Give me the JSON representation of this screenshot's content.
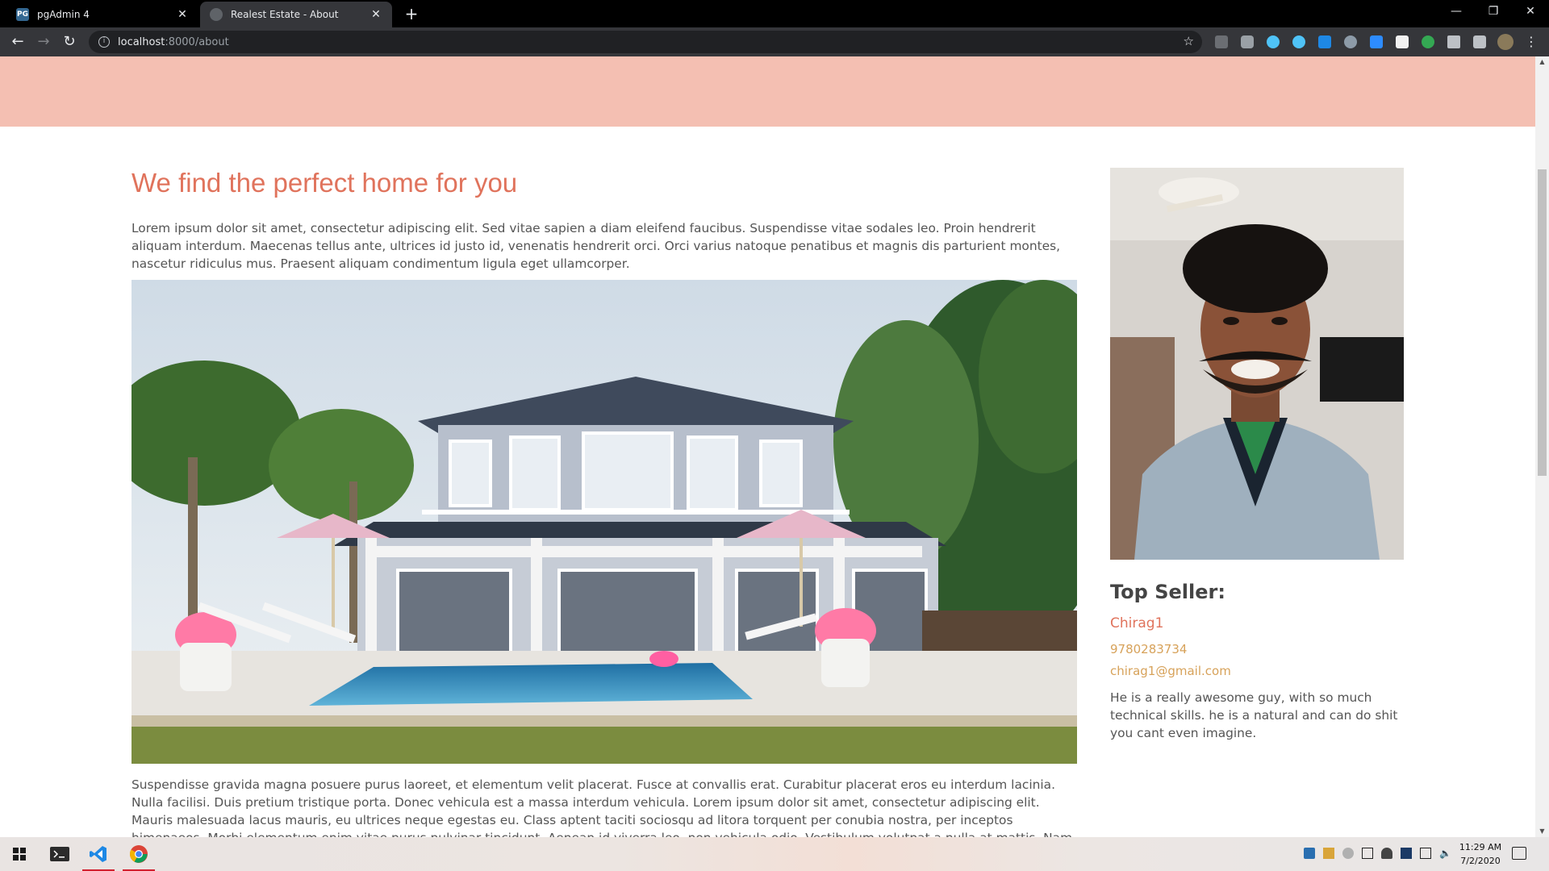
{
  "browser": {
    "tabs": [
      {
        "label": "pgAdmin 4",
        "favicon": "PG"
      },
      {
        "label": "Realest Estate - About"
      }
    ],
    "url_host": "localhost",
    "url_path": ":8000/about"
  },
  "page": {
    "heading": "We find the perfect home for you",
    "intro": "Lorem ipsum dolor sit amet, consectetur adipiscing elit. Sed vitae sapien a diam eleifend faucibus. Suspendisse vitae sodales leo. Proin hendrerit aliquam interdum. Maecenas tellus ante, ultrices id justo id, venenatis hendrerit orci. Orci varius natoque penatibus et magnis dis parturient montes, nascetur ridiculus mus. Praesent aliquam condimentum ligula eget ullamcorper.",
    "body": "Suspendisse gravida magna posuere purus laoreet, et elementum velit placerat. Fusce at convallis erat. Curabitur placerat eros eu interdum lacinia. Nulla facilisi. Duis pretium tristique porta. Donec vehicula est a massa interdum vehicula. Lorem ipsum dolor sit amet, consectetur adipiscing elit. Mauris malesuada lacus mauris, eu ultrices neque egestas eu. Class aptent taciti sociosqu ad litora torquent per conubia nostra, per inceptos himenaeos. Morbi elementum enim vitae purus pulvinar tincidunt. Aenean id viverra leo, non vehicula odio. Vestibulum volutpat a nulla at mattis. Nam cursus semper sapien."
  },
  "seller": {
    "title": "Top Seller:",
    "name": "Chirag1",
    "phone": "9780283734",
    "email": "chirag1@gmail.com",
    "bio": "He is a really awesome guy, with so much technical skills. he is a natural and can do shit you cant even imagine."
  },
  "taskbar": {
    "time": "11:29 AM",
    "date": "7/2/2020"
  },
  "colors": {
    "accent": "#e0735c",
    "link": "#d7a25a",
    "hero_band": "#f4bfb2"
  }
}
